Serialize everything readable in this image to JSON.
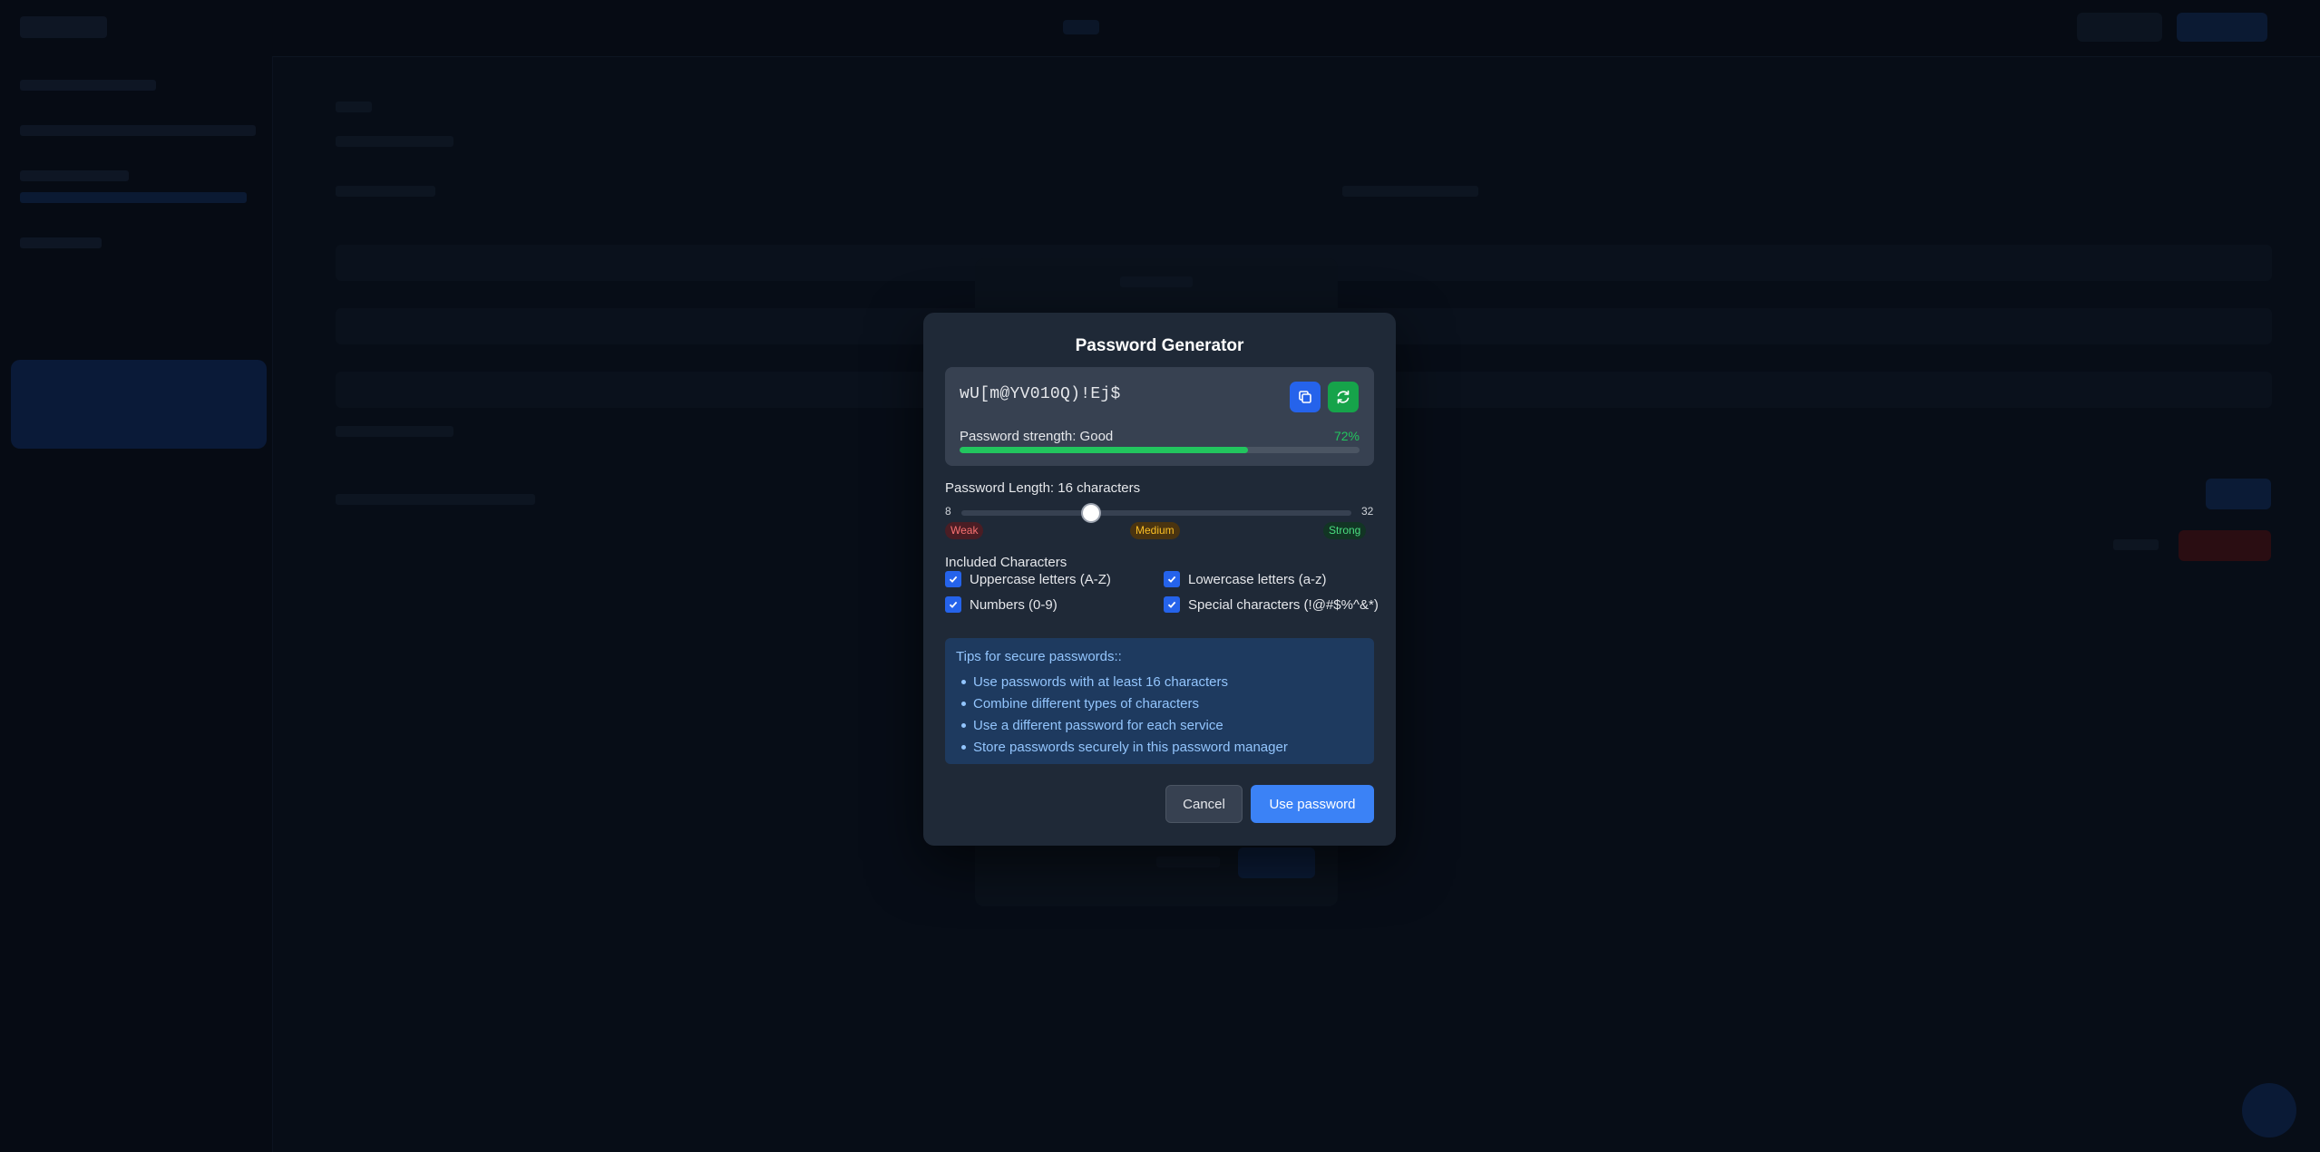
{
  "modal": {
    "title": "Password Generator",
    "password": "wU[m@YV010Q)!Ej$",
    "copy_icon": "copy-icon",
    "regenerate_icon": "refresh-icon",
    "strength": {
      "label": "Password strength: Good",
      "percent_text": "72%",
      "percent": 72,
      "color": "#22c55e"
    },
    "length": {
      "label": "Password Length: 16 characters",
      "min": "8",
      "max": "32",
      "value": 16,
      "levels": [
        "Weak",
        "Medium",
        "Strong"
      ]
    },
    "included": {
      "label": "Included Characters",
      "options": [
        {
          "label": "Uppercase letters (A-Z)",
          "checked": true
        },
        {
          "label": "Lowercase letters (a-z)",
          "checked": true
        },
        {
          "label": "Numbers (0-9)",
          "checked": true
        },
        {
          "label": "Special characters (!@#$%^&*)",
          "checked": true
        }
      ]
    },
    "tips": {
      "title": "Tips for secure passwords::",
      "items": [
        "Use passwords with at least 16 characters",
        "Combine different types of characters",
        "Use a different password for each service",
        "Store passwords securely in this password manager"
      ]
    },
    "buttons": {
      "cancel": "Cancel",
      "use": "Use password"
    }
  },
  "colors": {
    "accent": "#3b82f6",
    "success": "#22c55e",
    "overlay": "#050a13"
  }
}
